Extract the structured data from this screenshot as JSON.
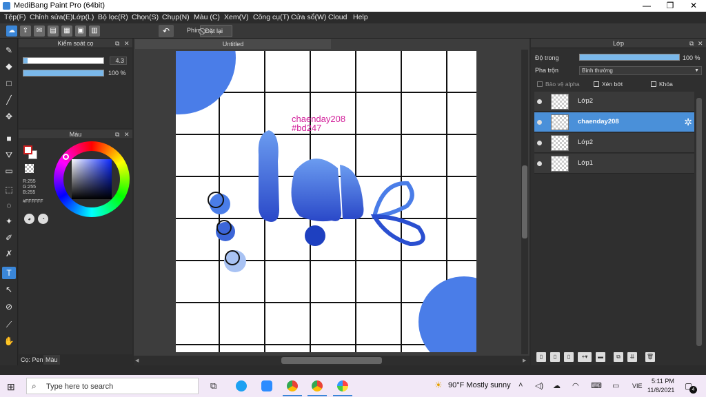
{
  "window": {
    "title": "MediBang Paint Pro (64bit)",
    "minimize": "—",
    "maximize": "❐",
    "close": "✕"
  },
  "menu": [
    "Tệp(F)",
    "Chỉnh sửa(E)",
    "Lớp(L)",
    "Bộ lọc(R)",
    "Chọn(S)",
    "Chụp(N)",
    "Màu (C)",
    "Xem(V)",
    "Công cụ(T)",
    "Cửa sổ(W)",
    "Cloud",
    "Help"
  ],
  "toolbar": {
    "undo_icon": "↶",
    "key_label": "Phím",
    "reset_label": "⃠ Đặt lại"
  },
  "tools": [
    {
      "name": "brush-tool",
      "glyph": "✎"
    },
    {
      "name": "eraser-tool",
      "glyph": "◆"
    },
    {
      "name": "rectangle-tool",
      "glyph": "□"
    },
    {
      "name": "pen-tool",
      "glyph": "╱"
    },
    {
      "name": "move-tool",
      "glyph": "✥"
    },
    {
      "name": "fill-rect-tool",
      "glyph": "■"
    },
    {
      "name": "bucket-tool",
      "glyph": "⛛"
    },
    {
      "name": "gradient-tool",
      "glyph": "▭"
    },
    {
      "name": "select-rect-tool",
      "glyph": "⬚"
    },
    {
      "name": "lasso-tool",
      "glyph": "◌"
    },
    {
      "name": "magic-wand-tool",
      "glyph": "✦"
    },
    {
      "name": "select-pen-tool",
      "glyph": "✐"
    },
    {
      "name": "select-eraser-tool",
      "glyph": "✗"
    },
    {
      "name": "text-tool",
      "glyph": "T",
      "active": true
    },
    {
      "name": "operation-tool",
      "glyph": "↖"
    },
    {
      "name": "eyedropper-tool",
      "glyph": "⊘"
    },
    {
      "name": "dropper-tool",
      "glyph": "⟋"
    },
    {
      "name": "hand-tool",
      "glyph": "✋"
    }
  ],
  "brush_panel": {
    "title": "Kiểm soát cọ",
    "size_value": "4.3",
    "size_fill": 0.05,
    "opacity_value": "100 %",
    "opacity_fill": 1.0
  },
  "color_panel": {
    "title": "Màu",
    "r": "R:255",
    "g": "G:255",
    "b": "B:255",
    "hex": "#FFFFFF",
    "fg_color": "#ffffff",
    "hue_color": "#0a28ff"
  },
  "left_tabs": [
    "Cọ: Pen",
    "Màu"
  ],
  "document": {
    "tab": "Untitled",
    "text_name": "chaenday208",
    "text_hex": "#bd247",
    "lettering": "la",
    "accent": "#4a7de8",
    "text_color": "#d21f9a"
  },
  "layer_panel": {
    "title": "Lớp",
    "opacity_label": "Độ trong",
    "opacity_value": "100 %",
    "blend_label": "Pha trộn",
    "blend_value": "Bình thường",
    "protect_alpha": "Bảo vệ alpha",
    "clipping": "Xén bớt",
    "lock": "Khóa",
    "layers": [
      {
        "name": "Lớp2",
        "selected": false
      },
      {
        "name": "chaenday208",
        "selected": true
      },
      {
        "name": "Lớp2",
        "selected": false
      },
      {
        "name": "Lớp1",
        "selected": false
      }
    ]
  },
  "taskbar": {
    "search_placeholder": "Type here to search",
    "weather": "90°F  Mostly sunny",
    "lang": "VIE",
    "time": "5:11 PM",
    "date": "11/8/2021",
    "notifications": "4"
  }
}
